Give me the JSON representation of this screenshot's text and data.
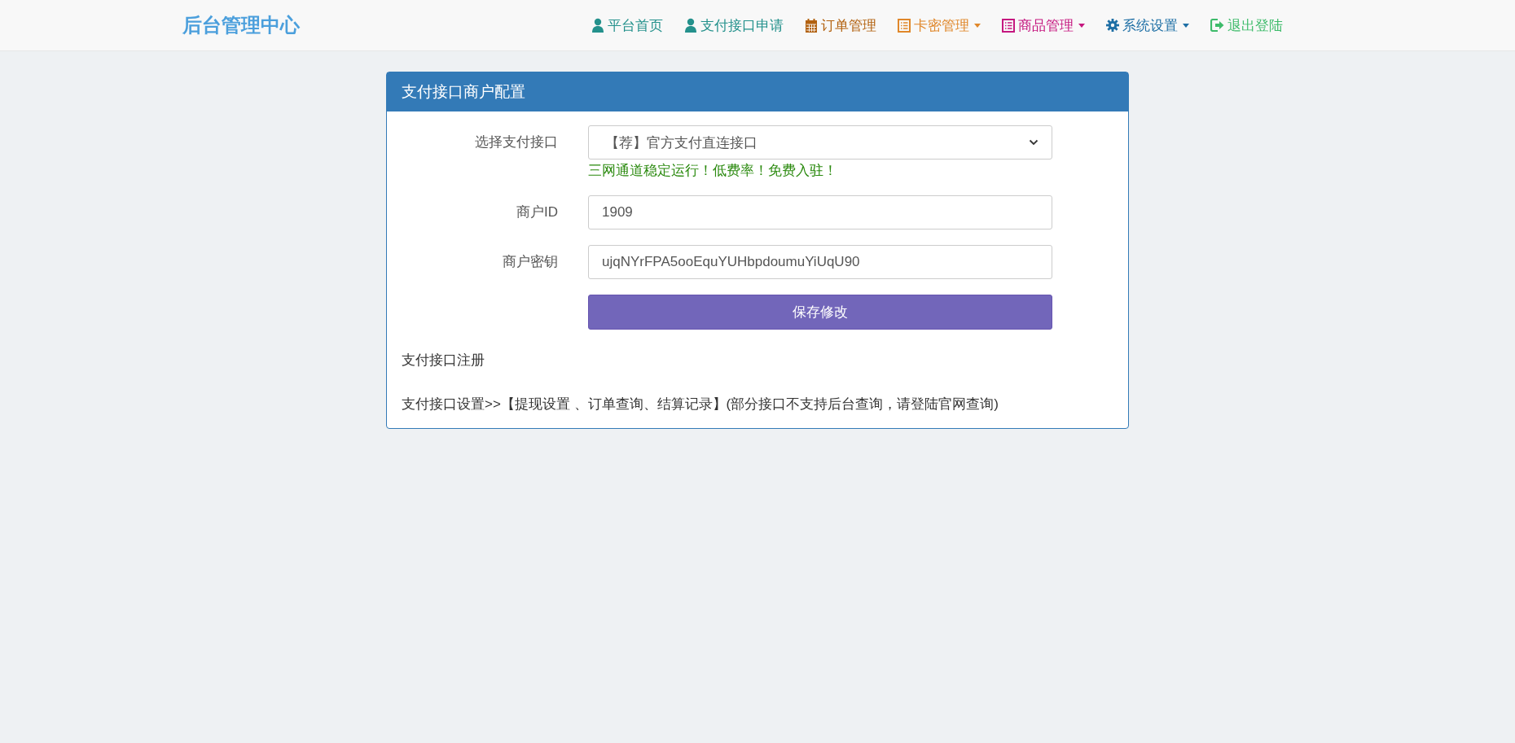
{
  "navbar": {
    "brand": "后台管理中心",
    "items": [
      {
        "label": "平台首页",
        "kind": "person",
        "color": "#24918c",
        "dropdown": false
      },
      {
        "label": "支付接口申请",
        "kind": "person",
        "color": "#24918c",
        "dropdown": false
      },
      {
        "label": "订单管理",
        "kind": "calendar",
        "color": "#b2610f",
        "dropdown": false
      },
      {
        "label": "卡密管理",
        "kind": "list",
        "color": "#e0872a",
        "dropdown": true
      },
      {
        "label": "商品管理",
        "kind": "list",
        "color": "#c5177f",
        "dropdown": true
      },
      {
        "label": "系统设置",
        "kind": "gear",
        "color": "#1e6fa5",
        "dropdown": true
      },
      {
        "label": "退出登陆",
        "kind": "exit",
        "color": "#3dbb6a",
        "dropdown": false
      }
    ]
  },
  "panel": {
    "title": "支付接口商户配置",
    "fields": [
      {
        "label": "选择支付接口",
        "kind": "select",
        "value": "【荐】官方支付直连接口",
        "hint": "三网通道稳定运行！低费率！免费入驻！"
      },
      {
        "label": "商户ID",
        "kind": "input",
        "value": "1909"
      },
      {
        "label": "商户密钥",
        "kind": "input",
        "value": "ujqNYrFPA5ooEquYUHbpdoumuYiUqU90"
      }
    ],
    "save_button": "保存修改",
    "register_text": "支付接口注册",
    "settings_text": "支付接口设置>>【提现设置 、订单查询、结算记录】(部分接口不支持后台查询，请登陆官网查询)"
  }
}
